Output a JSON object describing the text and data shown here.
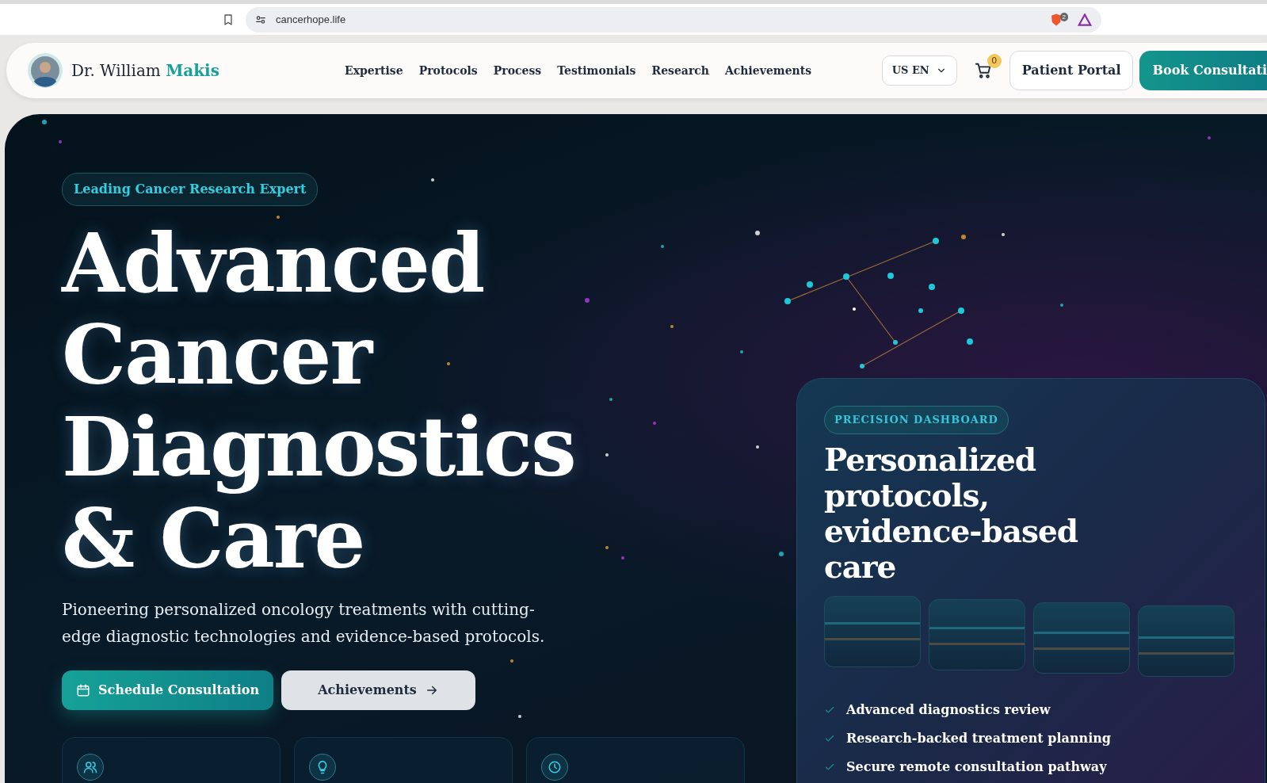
{
  "browser": {
    "url": "cancerhope.life",
    "shield_count": "2"
  },
  "nav": {
    "brand_name": "Dr. William",
    "brand_accent": "Makis",
    "links": [
      "Expertise",
      "Protocols",
      "Process",
      "Testimonials",
      "Research",
      "Achievements"
    ],
    "locale": "US EN",
    "cart_count": "0",
    "portal_button": "Patient Portal",
    "cta_button": "Book Consultati"
  },
  "hero": {
    "badge": "Leading Cancer Research Expert",
    "headline": [
      "Advanced",
      "Cancer",
      "Diagnostics",
      "& Care"
    ],
    "paragraph": "Pioneering personalized oncology treatments with cutting-edge diagnostic technologies and evidence-based protocols.",
    "buttons": [
      {
        "label": "Schedule Consultation",
        "kind": "primary"
      },
      {
        "label": "Achievements",
        "kind": "secondary"
      }
    ],
    "feature_cards": [
      {
        "kind": "people"
      },
      {
        "kind": "bulb"
      },
      {
        "kind": "clock"
      }
    ]
  },
  "dashboard": {
    "badge": "PRECISION DASHBOARD",
    "title": [
      "Personalized",
      "protocols,",
      "evidence-based",
      "care"
    ],
    "checklist": [
      "Advanced diagnostics review",
      "Research-backed treatment planning",
      "Secure remote consultation pathway"
    ]
  }
}
